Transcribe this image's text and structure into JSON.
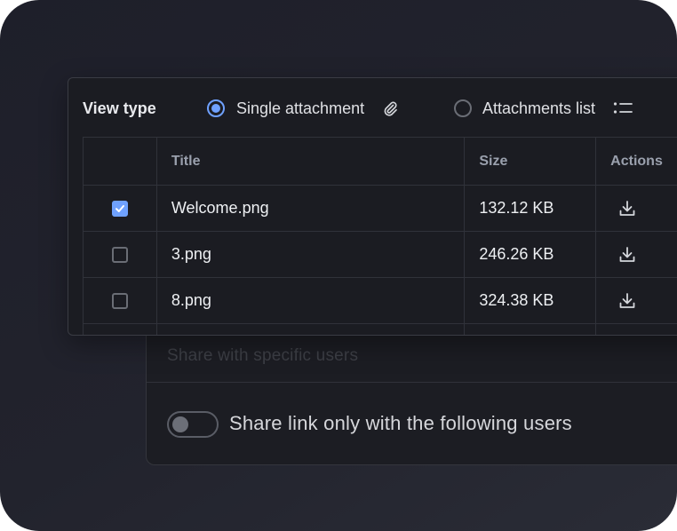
{
  "share": {
    "section_title": "Share with specific users",
    "toggle_label": "Share link only with the following users",
    "toggle_on": false
  },
  "view_type": {
    "label": "View type",
    "options": [
      {
        "label": "Single attachment",
        "selected": true,
        "icon": "paperclip-icon"
      },
      {
        "label": "Attachments list",
        "selected": false,
        "icon": "list-icon"
      }
    ]
  },
  "table": {
    "columns": [
      "Title",
      "Size",
      "Actions"
    ],
    "rows": [
      {
        "title": "Welcome.png",
        "size": "132.12 KB",
        "checked": true,
        "action_icon": "download-icon"
      },
      {
        "title": "3.png",
        "size": "246.26 KB",
        "checked": false,
        "action_icon": "download-icon"
      },
      {
        "title": "8.png",
        "size": "324.38 KB",
        "checked": false,
        "action_icon": "download-icon"
      }
    ]
  },
  "colors": {
    "accent": "#6fa1ff",
    "background": "#1e1f2a",
    "card": "#1b1c22"
  }
}
